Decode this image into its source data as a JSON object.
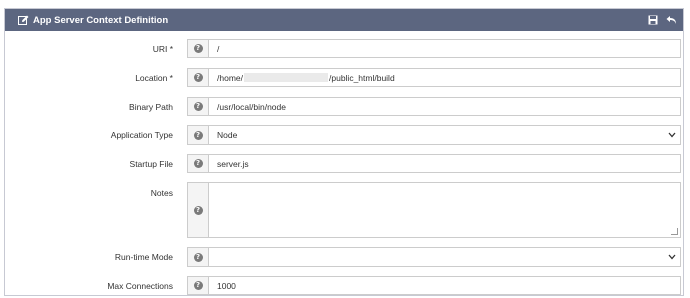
{
  "header": {
    "title": "App Server Context Definition",
    "save_icon": "save-icon",
    "back_icon": "undo-icon"
  },
  "fields": {
    "uri": {
      "label": "URI *",
      "value": "/"
    },
    "location": {
      "label": "Location *",
      "value_prefix": "/home/",
      "value_suffix": "/public_html/build"
    },
    "binary_path": {
      "label": "Binary Path",
      "value": "/usr/local/bin/node"
    },
    "app_type": {
      "label": "Application Type",
      "value": "Node"
    },
    "startup_file": {
      "label": "Startup File",
      "value": "server.js"
    },
    "notes": {
      "label": "Notes",
      "value": ""
    },
    "runtime_mode": {
      "label": "Run-time Mode",
      "value": ""
    },
    "max_connections": {
      "label": "Max Connections",
      "value": "1000"
    }
  },
  "help_glyph": "?",
  "colors": {
    "header_bg": "#5c6680",
    "border": "#cccccc"
  }
}
